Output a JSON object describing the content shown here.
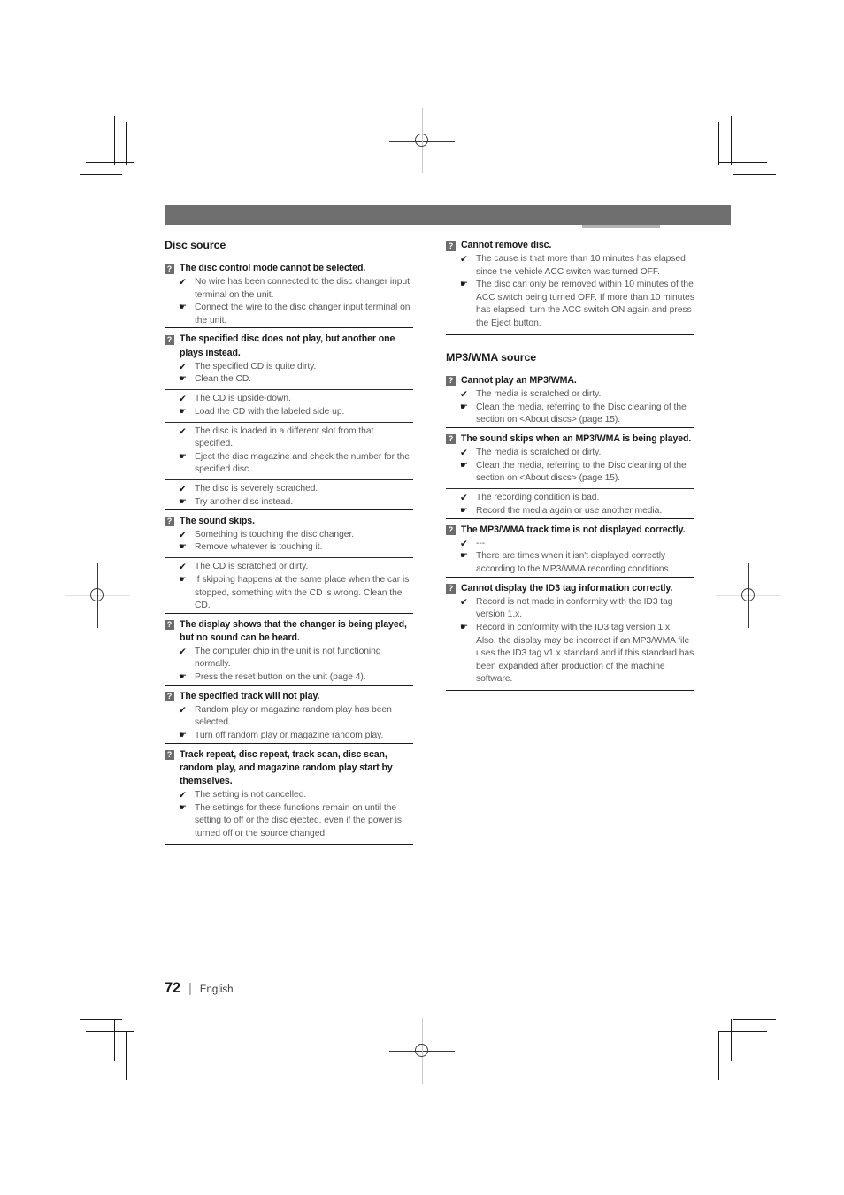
{
  "footer": {
    "page_number": "72",
    "separator": "|",
    "language": "English"
  },
  "glyphs": {
    "question": "?",
    "cause": "✔",
    "remedy": "☛"
  },
  "colors": {
    "header_bar": "#706f6f",
    "badge": "#6d6c6c",
    "heading_text": "#1a1a1a",
    "body_text": "#58585a"
  },
  "left_column": {
    "section_title": "Disc source",
    "problems": [
      {
        "question": "The disc control mode cannot be selected.",
        "groups": [
          {
            "cause": "No wire has been connected to the disc changer input terminal on the unit.",
            "remedy": "Connect the wire to the disc changer input terminal on the unit."
          }
        ]
      },
      {
        "question": "The specified disc does not play, but another one plays instead.",
        "groups": [
          {
            "cause": "The specified CD is quite dirty.",
            "remedy": "Clean the CD."
          },
          {
            "cause": "The CD is upside-down.",
            "remedy": "Load the CD with the labeled side up."
          },
          {
            "cause": "The disc is loaded in a different slot from that specified.",
            "remedy": "Eject the disc magazine and check the number for the specified disc."
          },
          {
            "cause": "The disc is severely scratched.",
            "remedy": "Try another disc instead."
          }
        ]
      },
      {
        "question": "The sound skips.",
        "groups": [
          {
            "cause": "Something is touching the disc changer.",
            "remedy": "Remove whatever is touching it."
          },
          {
            "cause": "The CD is scratched or dirty.",
            "remedy": "If skipping happens at the same place when the car is stopped, something with the CD is wrong. Clean the CD."
          }
        ]
      },
      {
        "question": "The display shows that the changer is being played, but no sound can be heard.",
        "groups": [
          {
            "cause": "The computer chip in the unit is not functioning normally.",
            "remedy": "Press the reset button on the unit (page 4)."
          }
        ]
      },
      {
        "question": "The specified track will not play.",
        "groups": [
          {
            "cause": "Random play or magazine random play has been selected.",
            "remedy": "Turn off random play or magazine random play."
          }
        ]
      },
      {
        "question": "Track repeat, disc repeat, track scan, disc scan, random play, and magazine random play start by themselves.",
        "groups": [
          {
            "cause": "The setting is not cancelled.",
            "remedy": "The settings for these functions remain on until the setting to off or the disc ejected, even if the power is turned off or the source changed."
          }
        ]
      }
    ]
  },
  "right_column": {
    "disc_source_continued": [
      {
        "question": "Cannot remove disc.",
        "groups": [
          {
            "cause": "The cause is that more than 10 minutes has elapsed since the vehicle ACC switch was turned OFF.",
            "remedy": "The disc can only be removed within 10 minutes of the ACC switch being turned OFF. If more than 10 minutes has elapsed, turn the ACC switch ON again and press the Eject button."
          }
        ]
      }
    ],
    "section_title": "MP3/WMA source",
    "problems": [
      {
        "question": "Cannot play an MP3/WMA.",
        "groups": [
          {
            "cause": "The media is scratched or dirty.",
            "remedy": "Clean the media, referring to the Disc cleaning of the section on <About discs> (page 15)."
          }
        ]
      },
      {
        "question": "The sound skips when an MP3/WMA is being played.",
        "groups": [
          {
            "cause": "The media is scratched or dirty.",
            "remedy": "Clean the media, referring to the Disc cleaning of the section on <About discs> (page 15)."
          },
          {
            "cause": "The recording condition is bad.",
            "remedy": "Record the media again or use another media."
          }
        ]
      },
      {
        "question": "The MP3/WMA track time is not displayed correctly.",
        "groups": [
          {
            "cause": "---",
            "remedy": "There are times when it isn't displayed correctly according to the MP3/WMA recording conditions."
          }
        ]
      },
      {
        "question": "Cannot display the ID3 tag information correctly.",
        "groups": [
          {
            "cause": "Record is not made in conformity with the ID3 tag version 1.x.",
            "remedy": "Record in conformity with the ID3 tag version 1.x.",
            "remedy_continued": "Also, the display may be incorrect if an MP3/WMA file uses the ID3 tag v1.x standard and if this standard has been expanded after production of the machine software."
          }
        ]
      }
    ]
  }
}
